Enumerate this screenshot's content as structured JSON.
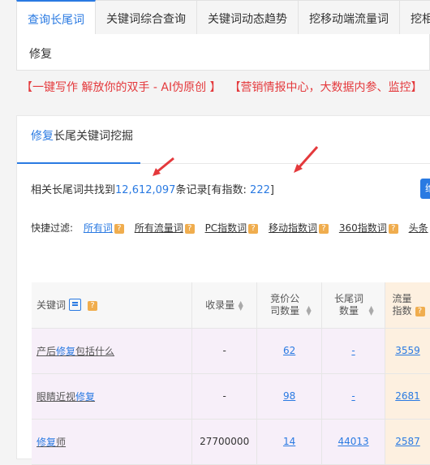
{
  "tabs": [
    "查询长尾词",
    "关键词综合查询",
    "关键词动态趋势",
    "挖移动端流量词",
    "挖相"
  ],
  "search": {
    "value": "修复"
  },
  "promo": {
    "left": "【一键写作 解放你的双手 - AI伪原创 】",
    "right": "【营销情报中心，大数据内参、监控】"
  },
  "panel": {
    "title_keyword": "修复",
    "title_rest": "长尾关键词挖掘",
    "records_prefix": "相关长尾词共找到",
    "records_count": "12,612,097",
    "records_mid": "条记录[有指数: ",
    "index_count": "222",
    "records_suffix": "]",
    "button_label": "维"
  },
  "filter": {
    "label": "快捷过滤:",
    "items": [
      "所有词",
      "所有流量词",
      "PC指数词",
      "移动指数词",
      "360指数词",
      "头条"
    ]
  },
  "table": {
    "headers": [
      "关键词",
      "收录量",
      "竞价公司数量",
      "长尾词数量",
      "流量指数"
    ],
    "rows": [
      {
        "pre": "产后",
        "kw": "修复",
        "post": "包括什么",
        "included": "-",
        "bid": "62",
        "longtail": "-",
        "flow": "3559"
      },
      {
        "pre": "眼睛近视",
        "kw": "修复",
        "post": "",
        "included": "-",
        "bid": "98",
        "longtail": "-",
        "flow": "2681"
      },
      {
        "pre": "",
        "kw": "修复",
        "post": "师",
        "included": "27700000",
        "bid": "14",
        "longtail": "44013",
        "flow": "2587"
      }
    ]
  },
  "colors": {
    "accent": "#2a7ae2",
    "promo": "#e4393c",
    "question_badge": "#f0ad4e",
    "row_bg": "#f7eff9",
    "flow_bg": "#fdf0e0"
  }
}
